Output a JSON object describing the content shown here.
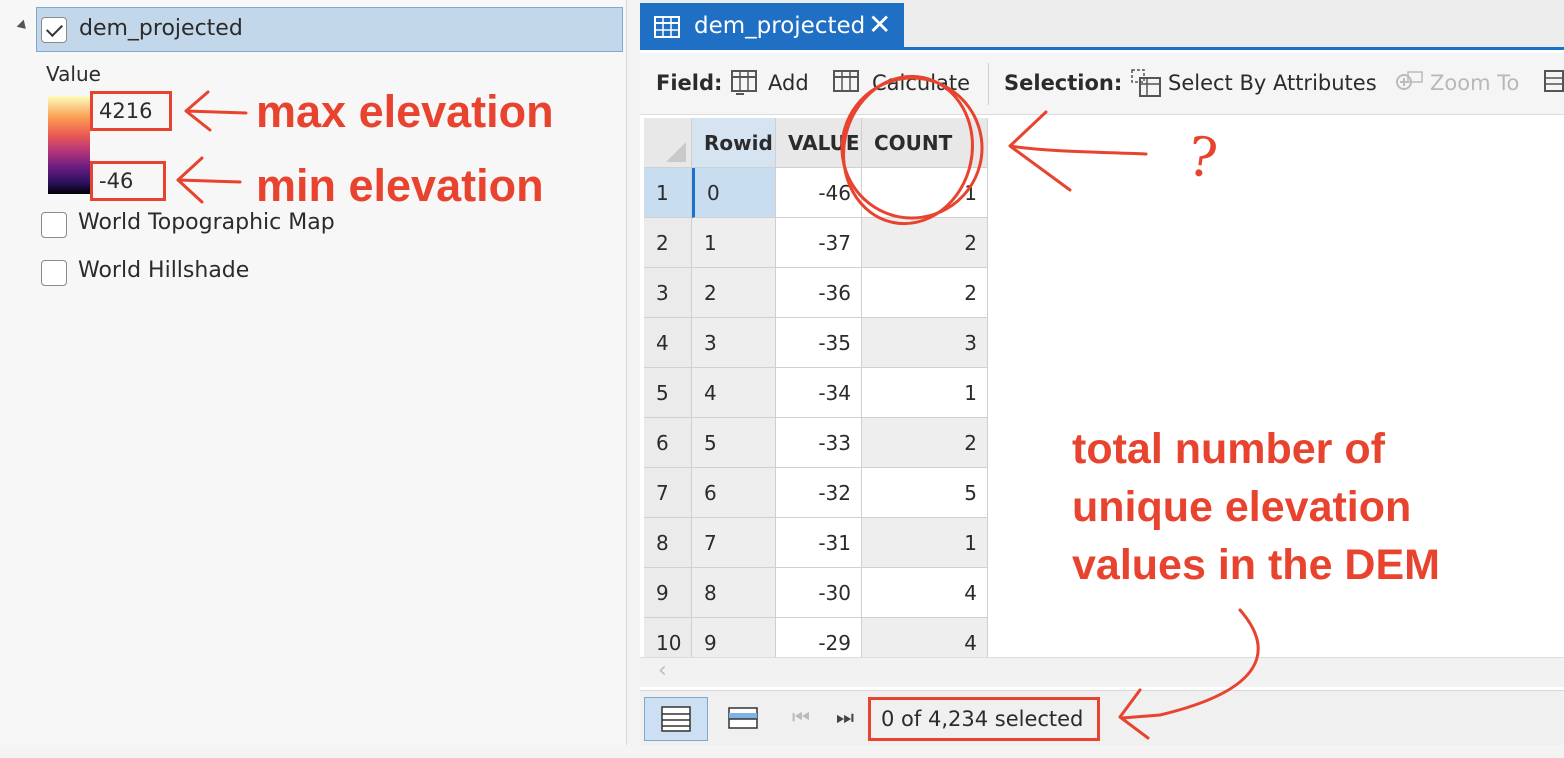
{
  "contents": {
    "layer_name": "dem_projected",
    "legend_title": "Value",
    "ramp_max": "4216",
    "ramp_min": "-46",
    "other_layers": [
      "World Topographic Map",
      "World Hillshade"
    ]
  },
  "annotations": {
    "max_note": "max elevation",
    "min_note": "min elevation",
    "question_mark": "?",
    "total_note_lines": [
      "total number of",
      "unique elevation",
      "values in the DEM"
    ],
    "color": "#e8432e"
  },
  "tab": {
    "title": "dem_projected",
    "close": "✕"
  },
  "toolbar": {
    "field_label": "Field:",
    "add": "Add",
    "calculate": "Calculate",
    "selection_label": "Selection:",
    "select_by_attributes": "Select By Attributes",
    "zoom_to": "Zoom To"
  },
  "table": {
    "columns": [
      "Rowid",
      "VALUE",
      "COUNT"
    ],
    "rows": [
      {
        "num": "1",
        "rowid": "0",
        "value": "-46",
        "count": "1"
      },
      {
        "num": "2",
        "rowid": "1",
        "value": "-37",
        "count": "2"
      },
      {
        "num": "3",
        "rowid": "2",
        "value": "-36",
        "count": "2"
      },
      {
        "num": "4",
        "rowid": "3",
        "value": "-35",
        "count": "3"
      },
      {
        "num": "5",
        "rowid": "4",
        "value": "-34",
        "count": "1"
      },
      {
        "num": "6",
        "rowid": "5",
        "value": "-33",
        "count": "2"
      },
      {
        "num": "7",
        "rowid": "6",
        "value": "-32",
        "count": "5"
      },
      {
        "num": "8",
        "rowid": "7",
        "value": "-31",
        "count": "1"
      },
      {
        "num": "9",
        "rowid": "8",
        "value": "-30",
        "count": "4"
      },
      {
        "num": "10",
        "rowid": "9",
        "value": "-29",
        "count": "4"
      }
    ]
  },
  "status": {
    "selected_text": "0 of 4,234 selected"
  },
  "icons": {
    "scroll_left": "‹",
    "first_page": "⏮",
    "last_page": "⏭"
  }
}
